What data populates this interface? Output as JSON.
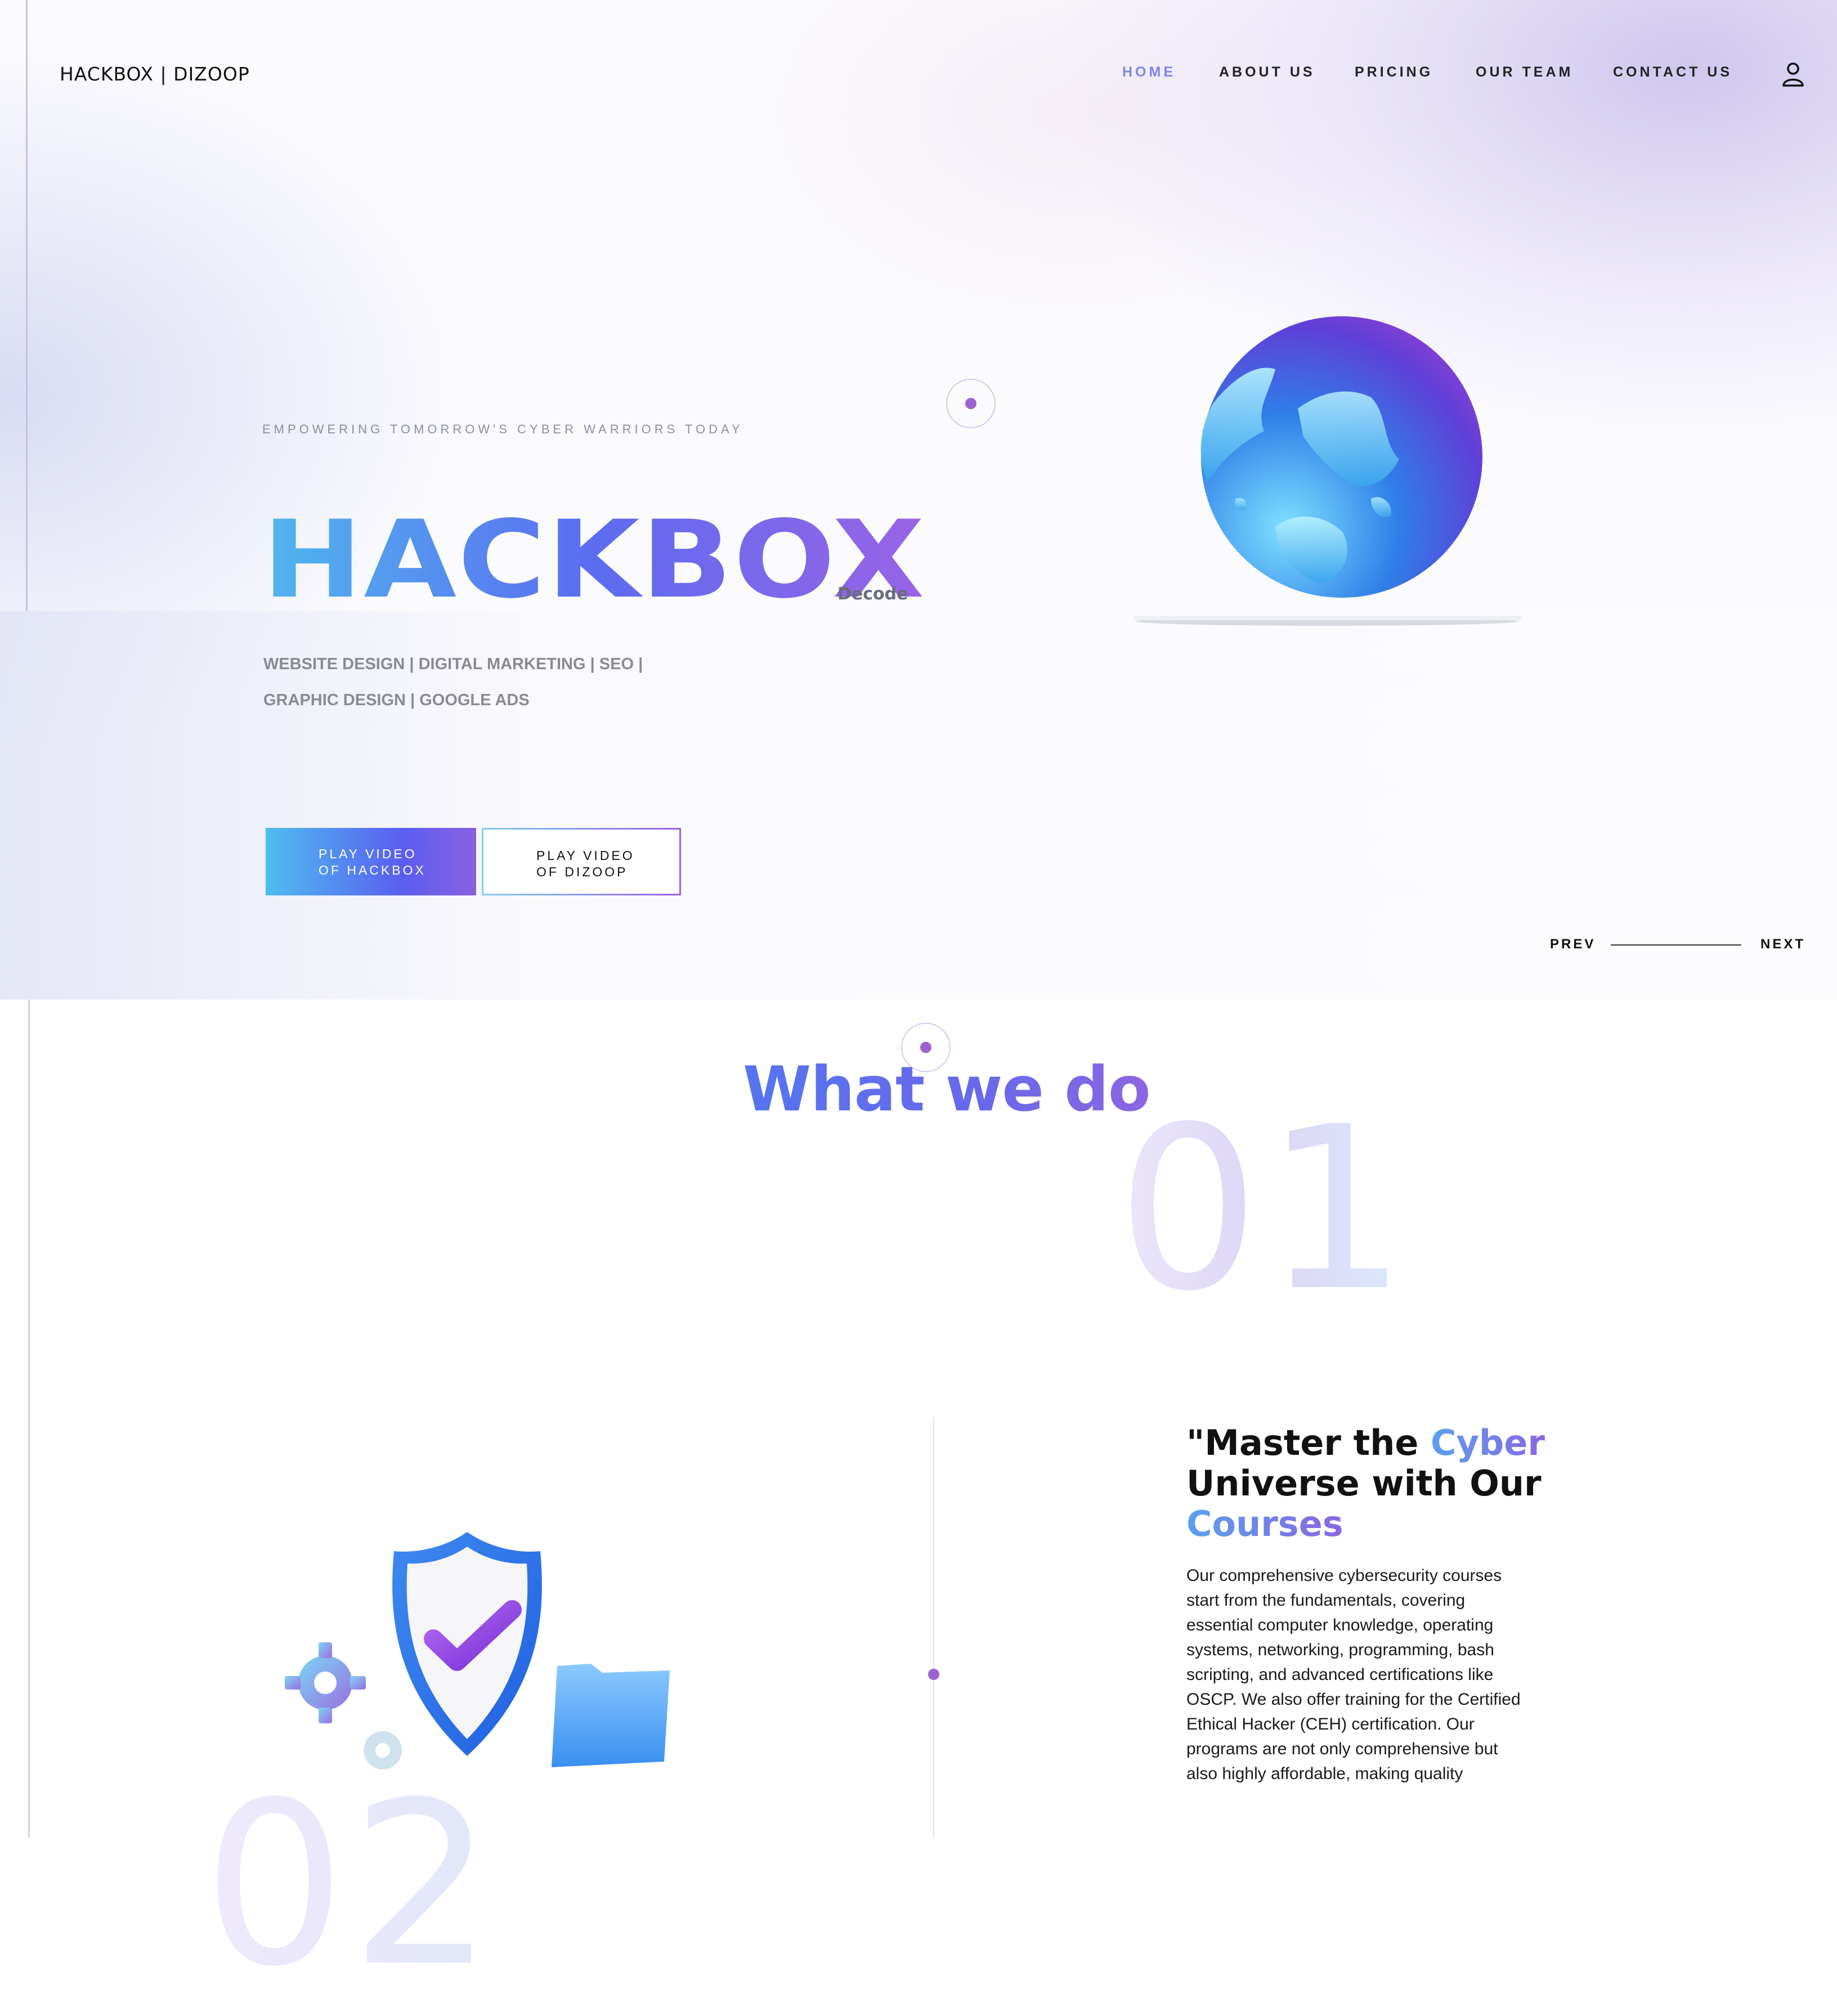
{
  "brand": {
    "logo": "HACKBOX | DIZOOP"
  },
  "nav": {
    "items": [
      {
        "label": "HOME",
        "active": true
      },
      {
        "label": "ABOUT US",
        "active": false
      },
      {
        "label": "PRICING",
        "active": false
      },
      {
        "label": "OUR TEAM",
        "active": false
      },
      {
        "label": "CONTACT US",
        "active": false
      }
    ],
    "user_icon": "user-icon"
  },
  "hero": {
    "tagline": "EMPOWERING TOMORROW'S CYBER WARRIORS TODAY",
    "title": "HACKBOX",
    "subtitle": "Decode",
    "services_line1": "WEBSITE DESIGN | DIGITAL MARKETING | SEO |",
    "services_line2": "GRAPHIC DESIGN | GOOGLE ADS",
    "button_primary": {
      "line1": "PLAY VIDEO",
      "line2": "OF HACKBOX"
    },
    "button_secondary": {
      "line1": "PLAY VIDEO",
      "line2": "OF DIZOOP"
    },
    "slider_prev": "PREV",
    "slider_next": "NEXT",
    "image": "globe-on-laptop"
  },
  "section": {
    "title": "What we do",
    "number": "01",
    "next_number": "02"
  },
  "card": {
    "title_part1": "\"Master the ",
    "title_highlight1": "Cyber",
    "title_part2": "Universe with Our",
    "title_highlight2": "Courses",
    "body": "Our comprehensive cybersecurity courses start from the fundamentals, covering essential computer knowledge, operating systems, networking, programming, bash scripting, and advanced certifications like OSCP. We also offer training for the Certified Ethical Hacker (CEH) certification. Our programs are not only comprehensive but also highly affordable, making quality",
    "image": "shield-checkmark-illustration"
  },
  "colors": {
    "accent_purple": "#9c63cf",
    "gradient_blue": "#4fb6ee",
    "gradient_indigo": "#5c6cf0",
    "gradient_violet": "#9a63e6",
    "nav_active": "#7e86e8"
  }
}
